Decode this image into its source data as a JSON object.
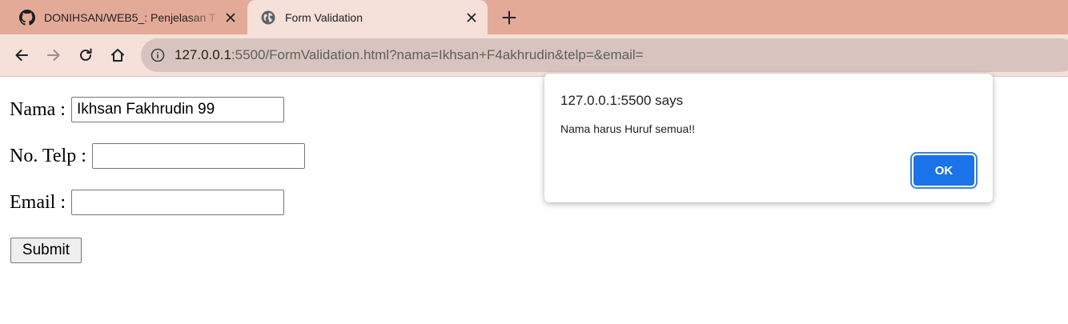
{
  "browser": {
    "tabs": [
      {
        "title": "DONIHSAN/WEB5_: Penjelasan T",
        "favicon": "github-icon",
        "active": false
      },
      {
        "title": "Form Validation",
        "favicon": "globe-icon",
        "active": true
      }
    ],
    "url_host": "127.0.0.1",
    "url_rest": ":5500/FormValidation.html?nama=Ikhsan+F4akhrudin&telp=&email="
  },
  "form": {
    "nama_label": "Nama :",
    "nama_value": "Ikhsan Fakhrudin 99",
    "telp_label": "No. Telp :",
    "telp_value": "",
    "email_label": "Email :",
    "email_value": "",
    "submit_label": "Submit"
  },
  "dialog": {
    "origin": "127.0.0.1:5500 says",
    "message": "Nama harus Huruf semua!!",
    "ok_label": "OK"
  },
  "colors": {
    "tabstrip": "#e4aa98",
    "toolbar": "#f5e0da",
    "omnibox": "#d8c4be",
    "accent": "#1a73e8"
  }
}
